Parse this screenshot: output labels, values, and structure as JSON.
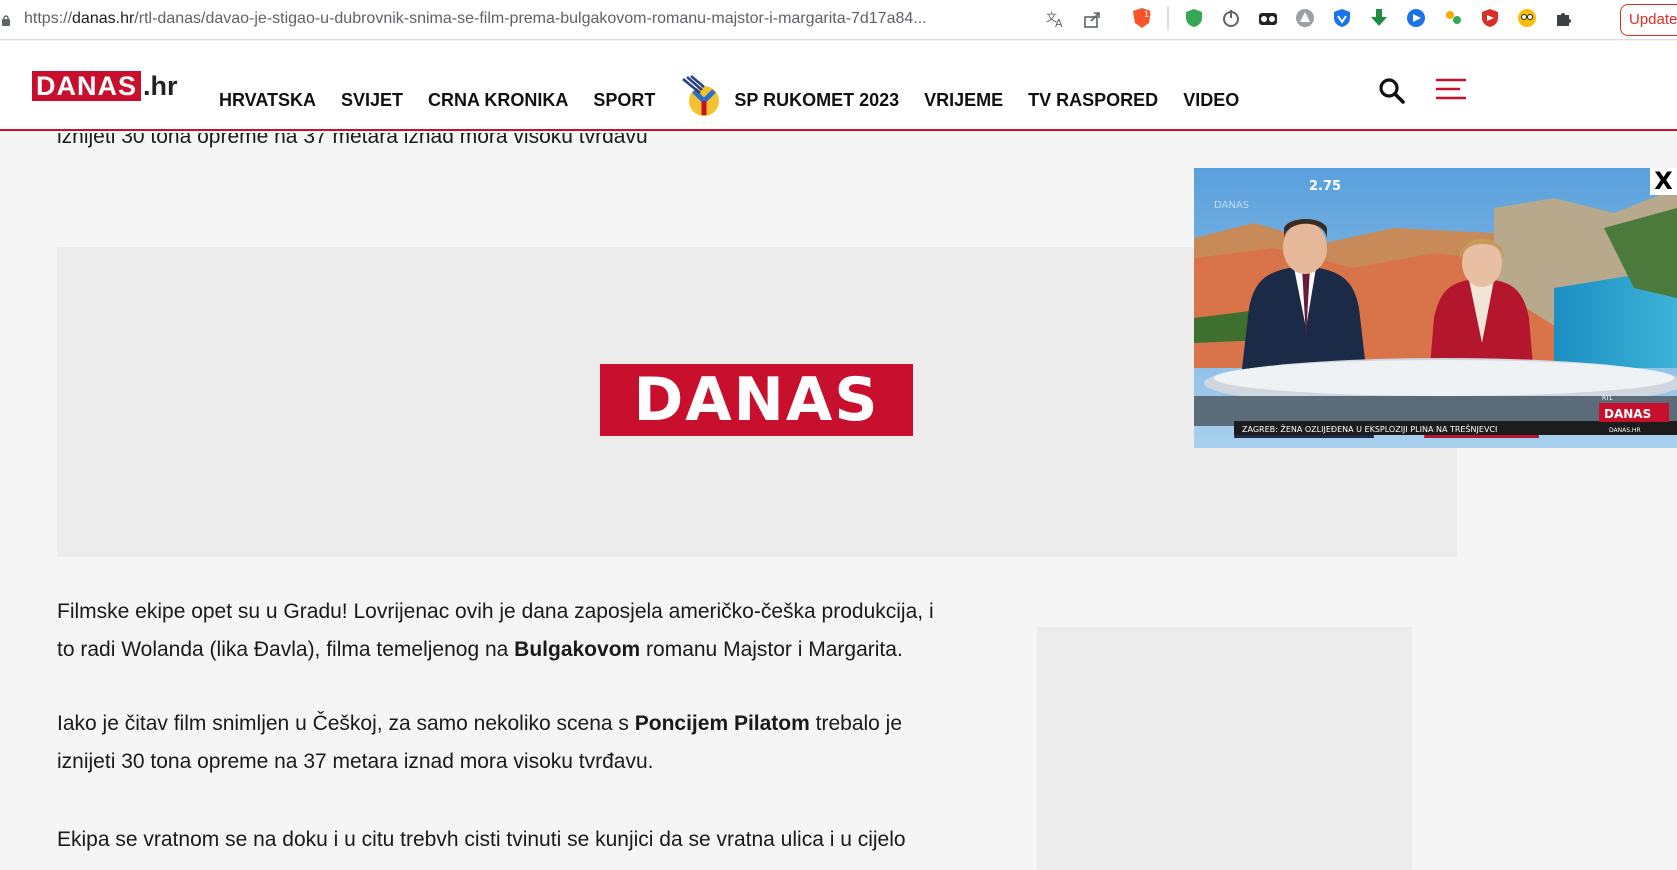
{
  "browser": {
    "url_prefix": "https://",
    "url_host": "danas.hr",
    "url_path": "/rtl-danas/davao-je-stigao-u-dubrovnik-snima-se-film-prema-bulgakovom-romanu-majstor-i-margarita-7d17a84...",
    "update_label": "Update",
    "brave_badge": "15"
  },
  "header": {
    "logo_text": "DANAS",
    "logo_ext": ".hr",
    "nav": [
      "HRVATSKA",
      "SVIJET",
      "CRNA KRONIKA",
      "SPORT",
      "SP RUKOMET 2023",
      "VRIJEME",
      "TV RASPORED",
      "VIDEO"
    ]
  },
  "content": {
    "top_text": "iznijeti 30 tona opreme na 37 metara iznad mora visoku tvrđavu",
    "ad_logo": "DANAS",
    "p1_a": "Filmske ekipe opet su u Gradu! Lovrijenac ovih je dana zaposjela američko-češka produkcija, i to radi Wolanda (lika Đavla), filma temeljenog na ",
    "p1_b": "Bulgakovom",
    "p1_c": " romanu Majstor i Margarita.",
    "p2_a": "Iako je čitav film snimljen u Češkoj, za samo nekoliko scena s ",
    "p2_b": "Poncijem Pilatom",
    "p2_c": " trebalo je iznijeti 30 tona opreme na 37 metara iznad mora visoku tvrđavu.",
    "p3": "Ekipa se vratnom se na doku i u citu trebvh cisti tvinuti se kunjici da se vratna ulica i u cijelo"
  },
  "video": {
    "close_label": "X",
    "counter": "2.75",
    "ticker": "ZAGREB: ŽENA OZLIJEĐENA U EKSPLOZIJI PLINA NA TREŠNJEVCI",
    "badge_top": "RTL",
    "badge": "DANAS",
    "badge_sub": "DANAS.HR",
    "watermark": "DANAS"
  },
  "colors": {
    "brand": "#c8102e"
  }
}
